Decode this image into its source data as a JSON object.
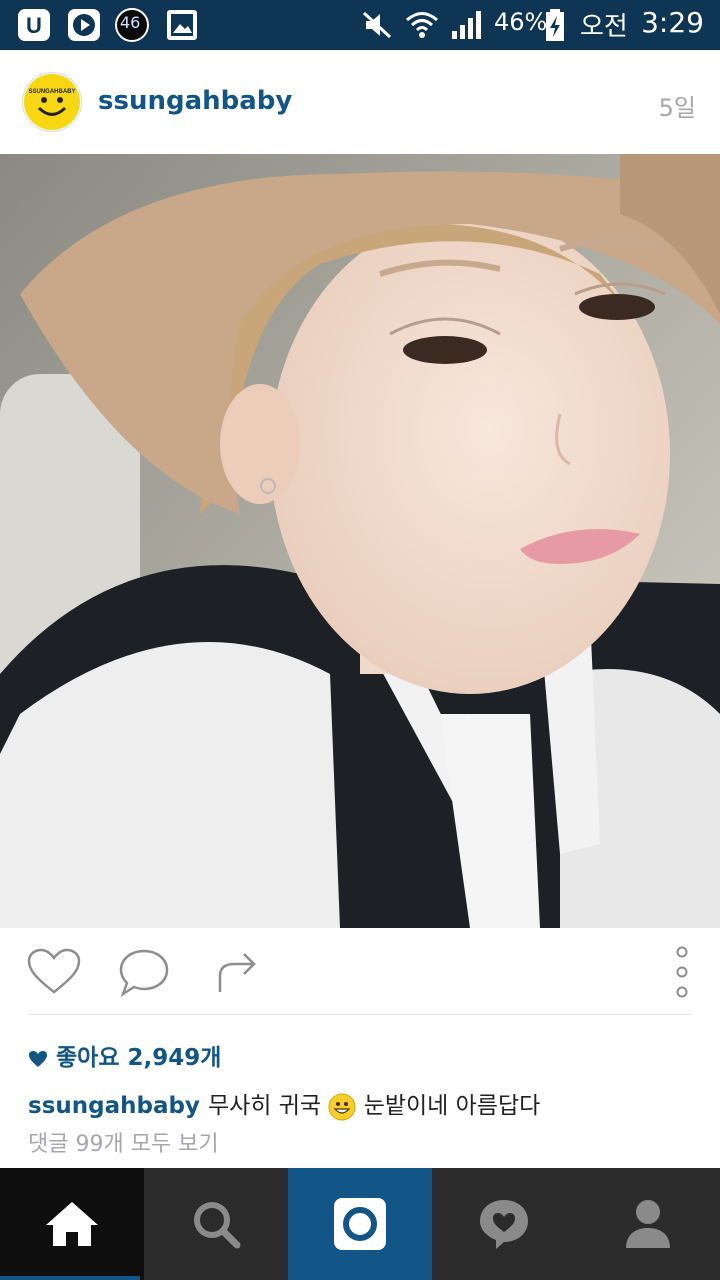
{
  "status_bar": {
    "network_badge": "46",
    "battery": "46%",
    "ampm": "오전",
    "time": "3:29"
  },
  "post": {
    "username": "ssungahbaby",
    "avatar_text": "SSUNGAHBABY",
    "time_ago": "5일",
    "likes_text": "좋아요 2,949개",
    "caption_user": "ssungahbaby",
    "caption_part1": "무사히 귀국",
    "caption_part2": "눈밭이네 아름답다",
    "comments_link": "댓글 99개 모두 보기"
  },
  "colors": {
    "status_bar": "#0e3553",
    "brand_blue": "#125688",
    "nav_dark": "#1a1a1a",
    "nav_mid": "#2b2b2b",
    "nav_camera": "#125688"
  },
  "icons": [
    "home-icon",
    "search-icon",
    "camera-icon",
    "activity-heart-icon",
    "profile-icon",
    "like-icon",
    "comment-icon",
    "share-icon",
    "more-icon"
  ]
}
